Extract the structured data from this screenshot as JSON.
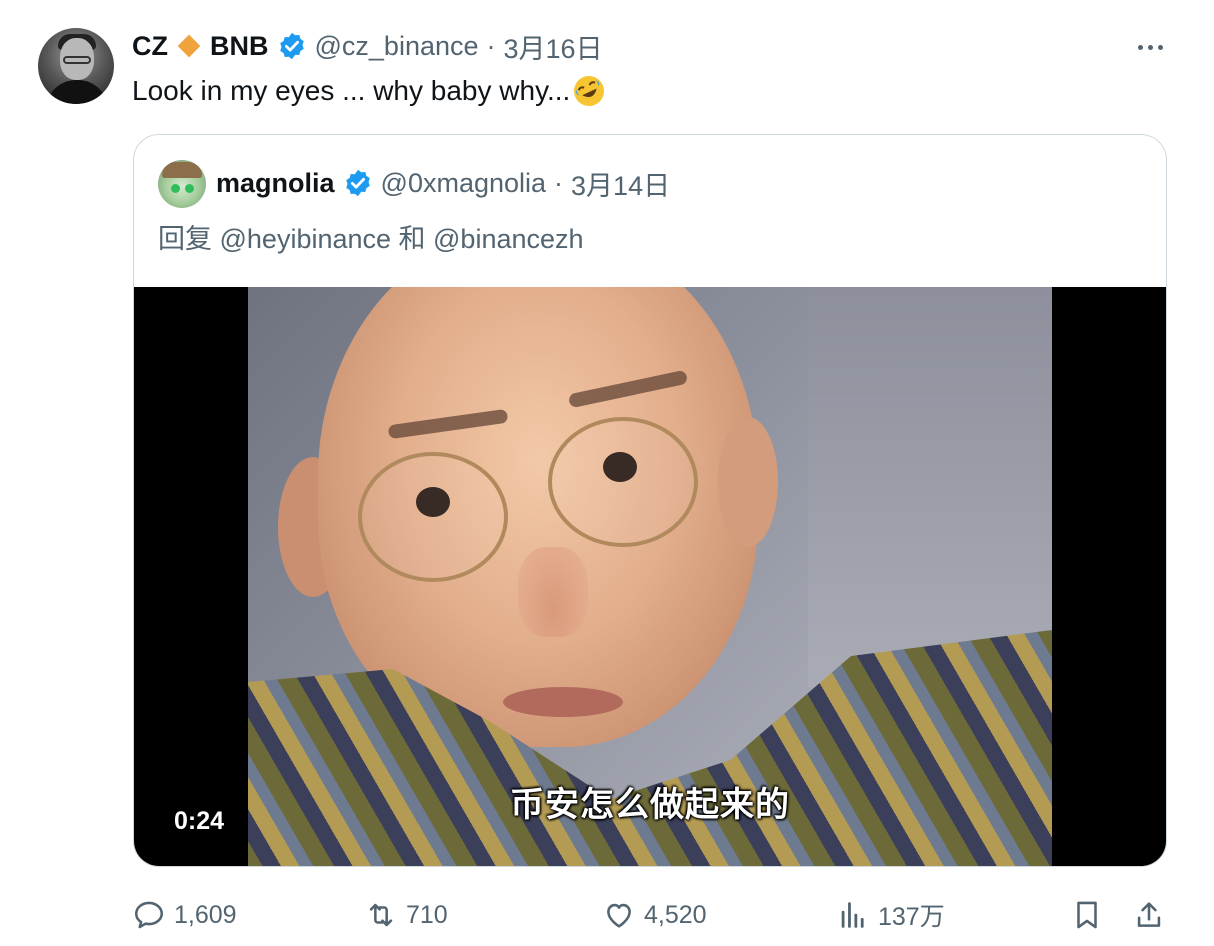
{
  "tweet": {
    "author": {
      "display_name": "CZ",
      "name_suffix": "BNB",
      "handle": "@cz_binance",
      "separator": "·",
      "date": "3月16日"
    },
    "text": "Look in my eyes ... why baby why...",
    "emoji": "rolling-on-floor-laughing",
    "quoted": {
      "display_name": "magnolia",
      "handle": "@0xmagnolia",
      "separator": "·",
      "date": "3月14日",
      "reply_line": "回复 @heyibinance 和 @binancezh",
      "video": {
        "subtitle": "币安怎么做起来的",
        "duration": "0:24"
      }
    },
    "actions": {
      "replies": "1,609",
      "retweets": "710",
      "likes": "4,520",
      "views": "137万"
    }
  },
  "colors": {
    "text_primary": "#0f1419",
    "text_secondary": "#536471",
    "verified_blue": "#1d9bf0",
    "border": "#cfd9de",
    "bnb_orange": "#f0a33c"
  },
  "icons": [
    "more-icon",
    "verified-icon",
    "bnb-diamond-icon",
    "reply-icon",
    "retweet-icon",
    "like-icon",
    "views-icon",
    "bookmark-icon",
    "share-icon"
  ]
}
